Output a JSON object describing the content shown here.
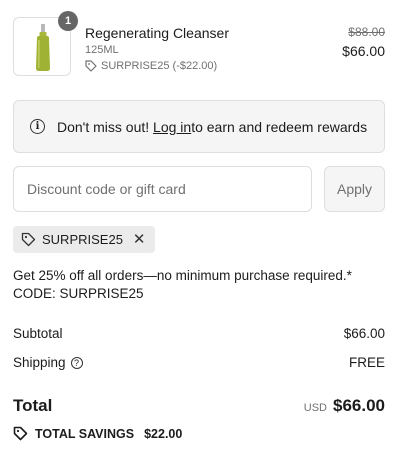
{
  "product": {
    "quantity": "1",
    "name": "Regenerating Cleanser",
    "size": "125ML",
    "discount_tag": "SURPRISE25 (-$22.00)",
    "original_price": "$88.00",
    "price": "$66.00"
  },
  "notice": {
    "text_before": "Don't miss out! ",
    "link": "Log in",
    "text_after": " to earn and redeem rewards"
  },
  "discount": {
    "placeholder": "Discount code or gift card",
    "apply_label": "Apply",
    "applied_code": "SURPRISE25"
  },
  "promo_text": "Get 25% off all orders—no minimum purchase required.* CODE: SURPRISE25",
  "summary": {
    "subtotal_label": "Subtotal",
    "subtotal_value": "$66.00",
    "shipping_label": "Shipping",
    "shipping_value": "FREE",
    "total_label": "Total",
    "currency": "USD",
    "total_value": "$66.00",
    "savings_label": "TOTAL SAVINGS",
    "savings_value": "$22.00"
  }
}
